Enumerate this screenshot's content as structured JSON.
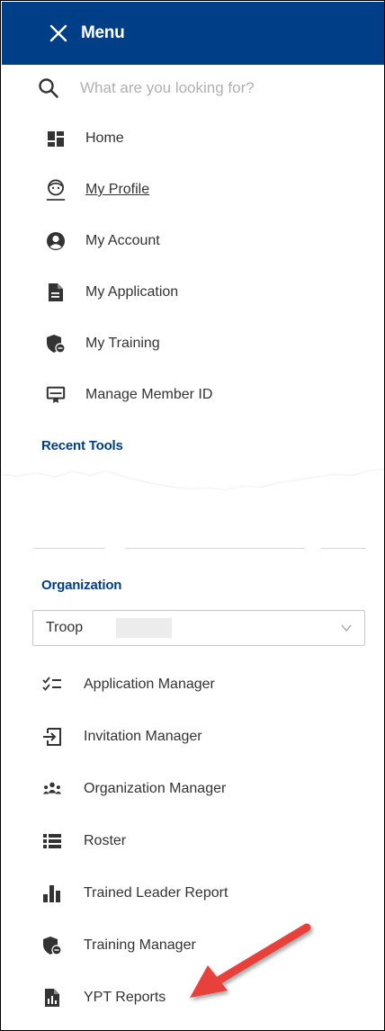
{
  "header": {
    "title": "Menu",
    "close_icon": "close-icon"
  },
  "search": {
    "placeholder": "What are you looking for?",
    "value": "",
    "icon": "search-icon"
  },
  "main_nav": [
    {
      "label": "Home",
      "icon": "dashboard-icon"
    },
    {
      "label": "My Profile",
      "icon": "profile-face-icon",
      "active": true
    },
    {
      "label": "My Account",
      "icon": "account-circle-icon"
    },
    {
      "label": "My Application",
      "icon": "document-icon"
    },
    {
      "label": "My Training",
      "icon": "shield-training-icon"
    },
    {
      "label": "Manage Member ID",
      "icon": "member-id-card-icon"
    }
  ],
  "recent_tools": {
    "title": "Recent Tools"
  },
  "organization": {
    "title": "Organization",
    "selected_unit": "Troop",
    "dropdown_icon": "chevron-down-icon"
  },
  "org_tools": [
    {
      "label": "Application Manager",
      "icon": "checklist-icon"
    },
    {
      "label": "Invitation Manager",
      "icon": "sign-in-icon"
    },
    {
      "label": "Organization Manager",
      "icon": "group-icon"
    },
    {
      "label": "Roster",
      "icon": "list-icon"
    },
    {
      "label": "Trained Leader Report",
      "icon": "bar-chart-icon"
    },
    {
      "label": "Training Manager",
      "icon": "shield-training-icon"
    },
    {
      "label": "YPT Reports",
      "icon": "report-document-icon"
    }
  ],
  "colors": {
    "header_bg": "#003f87",
    "section_title": "#003f87",
    "annotation_arrow": "#e8403a"
  }
}
